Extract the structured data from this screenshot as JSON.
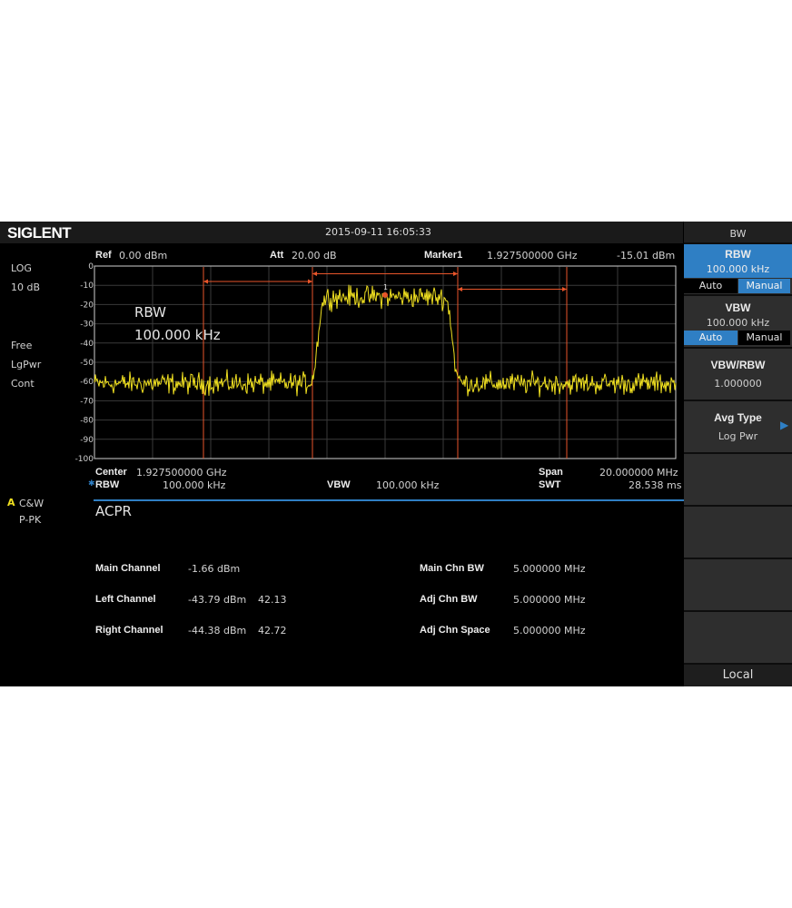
{
  "brand": "SIGLENT",
  "datetime": "2015-09-11   16:05:33",
  "header": {
    "ref_label": "Ref",
    "ref_value": "0.00 dBm",
    "att_label": "Att",
    "att_value": "20.00 dB",
    "marker_label": "Marker1",
    "marker_freq": "1.927500000  GHz",
    "marker_level": "-15.01 dBm"
  },
  "left_info": {
    "scale_type": "LOG",
    "scale_div": "10 dB",
    "trig": "Free",
    "detector": "LgPwr",
    "sweep": "Cont"
  },
  "trace_info": {
    "trace": "A",
    "mode": "C&W",
    "detector": "P-PK"
  },
  "plot_overlay": {
    "line1": "RBW",
    "line2": "100.000  kHz",
    "marker_num": "1"
  },
  "y_ticks": [
    "0",
    "-10",
    "-20",
    "-30",
    "-40",
    "-50",
    "-60",
    "-70",
    "-80",
    "-90",
    "-100"
  ],
  "chart_data": {
    "type": "line",
    "xlim": [
      1917.5,
      1937.5
    ],
    "ylim": [
      -100,
      0
    ],
    "grid": true,
    "noise_floor": -61,
    "channel_top": -16,
    "main_channel": [
      1925.0,
      1930.0
    ],
    "left_channel": [
      1917.5,
      1925.0
    ],
    "right_channel": [
      1930.0,
      1937.5
    ],
    "channel_lines": [
      1921.25,
      1925.0,
      1930.0,
      1933.75
    ],
    "marker": {
      "x": 1927.5,
      "y": -15.01
    }
  },
  "footer": {
    "center_label": "Center",
    "center_value": "1.927500000  GHz",
    "span_label": "Span",
    "span_value": "20.000000  MHz",
    "rbw_label": "RBW",
    "rbw_value": "100.000  kHz",
    "vbw_label": "VBW",
    "vbw_value": "100.000  kHz",
    "swt_label": "SWT",
    "swt_value": "28.538 ms"
  },
  "measure": {
    "title": "ACPR",
    "rows": [
      {
        "label": "Main Channel",
        "value": "-1.66 dBm",
        "extra": "",
        "label2": "Main Chn BW",
        "value2": "5.000000  MHz"
      },
      {
        "label": "Left Channel",
        "value": "-43.79 dBm",
        "extra": "42.13",
        "label2": "Adj Chn BW",
        "value2": "5.000000  MHz"
      },
      {
        "label": "Right Channel",
        "value": "-44.38 dBm",
        "extra": "42.72",
        "label2": "Adj Chn Space",
        "value2": "5.000000  MHz"
      }
    ]
  },
  "softkeys": {
    "menu_title": "BW",
    "rbw_title": "RBW",
    "rbw_value": "100.000  kHz",
    "rbw_auto": "Auto",
    "rbw_manual": "Manual",
    "vbw_title": "VBW",
    "vbw_value": "100.000  kHz",
    "vbw_auto": "Auto",
    "vbw_manual": "Manual",
    "ratio_title": "VBW/RBW",
    "ratio_value": "1.000000",
    "avg_title": "Avg Type",
    "avg_value": "Log Pwr",
    "local": "Local"
  },
  "colors": {
    "trace": "#f0e020",
    "channel_line": "#e8552a",
    "selection": "#2f7fc4",
    "grid": "#3a3a3a"
  }
}
